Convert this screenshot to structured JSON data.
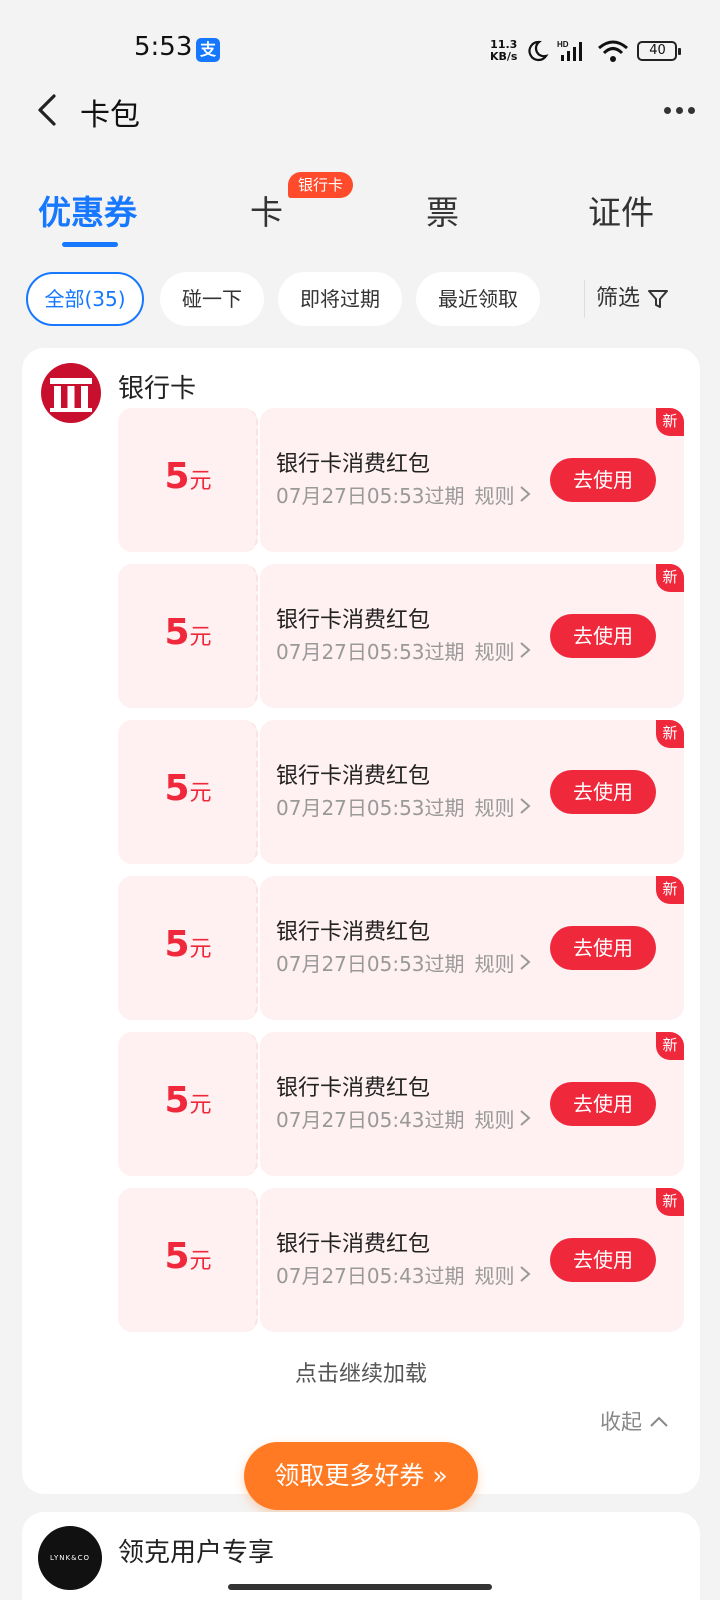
{
  "status_bar": {
    "time": "5:53",
    "app_icon": "支",
    "net_speed_top": "11.3",
    "net_speed_bottom": "KB/s",
    "battery": "40"
  },
  "header": {
    "title": "卡包"
  },
  "tabs": [
    {
      "label": "优惠券",
      "active": true
    },
    {
      "label": "卡"
    },
    {
      "label": "票"
    },
    {
      "label": "证件"
    }
  ],
  "tab_badge": "银行卡",
  "filters": {
    "chips": [
      "全部(35)",
      "碰一下",
      "即将过期",
      "最近领取"
    ],
    "filter_label": "筛选"
  },
  "bank_section": {
    "name": "银行卡",
    "coupons": [
      {
        "amount": "5",
        "unit": "元",
        "title": "银行卡消费红包",
        "expiry": "07月27日05:53过期",
        "rule": "规则",
        "action": "去使用",
        "tag": "新"
      },
      {
        "amount": "5",
        "unit": "元",
        "title": "银行卡消费红包",
        "expiry": "07月27日05:53过期",
        "rule": "规则",
        "action": "去使用",
        "tag": "新"
      },
      {
        "amount": "5",
        "unit": "元",
        "title": "银行卡消费红包",
        "expiry": "07月27日05:53过期",
        "rule": "规则",
        "action": "去使用",
        "tag": "新"
      },
      {
        "amount": "5",
        "unit": "元",
        "title": "银行卡消费红包",
        "expiry": "07月27日05:53过期",
        "rule": "规则",
        "action": "去使用",
        "tag": "新"
      },
      {
        "amount": "5",
        "unit": "元",
        "title": "银行卡消费红包",
        "expiry": "07月27日05:43过期",
        "rule": "规则",
        "action": "去使用",
        "tag": "新"
      },
      {
        "amount": "5",
        "unit": "元",
        "title": "银行卡消费红包",
        "expiry": "07月27日05:43过期",
        "rule": "规则",
        "action": "去使用",
        "tag": "新"
      }
    ],
    "load_more": "点击继续加载",
    "collapse": "收起"
  },
  "get_more_button": "领取更多好券 »",
  "second_section": {
    "logo_text": "LYNK&CO",
    "title": "领克用户专享"
  },
  "colors": {
    "accent_blue": "#1677ff",
    "coupon_red": "#f0283c",
    "orange_cta": "#ff7a22"
  }
}
